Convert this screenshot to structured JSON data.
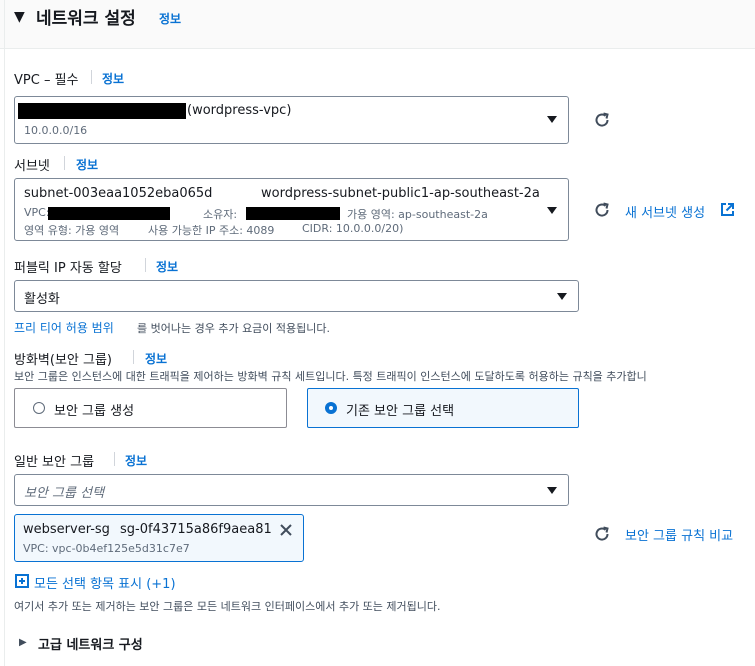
{
  "section": {
    "title": "네트워크 설정",
    "info": "정보"
  },
  "vpc": {
    "label": "VPC – 필수",
    "info": "정보",
    "name_suffix": "(wordpress-vpc)",
    "cidr": "10.0.0.0/16"
  },
  "subnet": {
    "label": "서브넷",
    "info": "정보",
    "id": "subnet-003eaa1052eba065d",
    "name": "wordpress-subnet-public1-ap-southeast-2a",
    "vpc_prefix": "VPC:",
    "owner_label": "소유자:",
    "az": "가용 영역: ap-southeast-2a",
    "zone_type": "영역 유형: 가용 영역",
    "available_ip": "사용 가능한 IP 주소: 4089",
    "cidr": "CIDR: 10.0.0.0/20)",
    "create_link": "새 서브넷 생성"
  },
  "public_ip": {
    "label": "퍼블릭 IP 자동 할당",
    "info": "정보",
    "value": "활성화",
    "free_tier_link": "프리 티어 허용 범위",
    "note": "를 벗어나는 경우 추가 요금이 적용됩니다."
  },
  "firewall": {
    "label": "방화벽(보안 그룹)",
    "info": "정보",
    "description": "보안 그룹은 인스턴스에 대한 트래픽을 제어하는 방화벽 규칙 세트입니다. 특정 트래픽이 인스턴스에 도달하도록 허용하는 규칙을 추가합니",
    "option_create": "보안 그룹 생성",
    "option_existing": "기존 보안 그룹 선택"
  },
  "sg": {
    "label": "일반 보안 그룹",
    "info": "정보",
    "placeholder": "보안 그룹 선택",
    "token_name": "webserver-sg",
    "token_id": "sg-0f43715a86f9aea81",
    "token_vpc": "VPC: vpc-0b4ef125e5d31c7e7",
    "compare_link": "보안 그룹 규칙 비교",
    "show_all": "모든 선택 항목 표시 (+1)",
    "note": "여기서 추가 또는 제거하는 보안 그룹은 모든 네트워크 인터페이스에서 추가 또는 제거됩니다."
  },
  "advanced": {
    "label": "고급 네트워크 구성"
  }
}
